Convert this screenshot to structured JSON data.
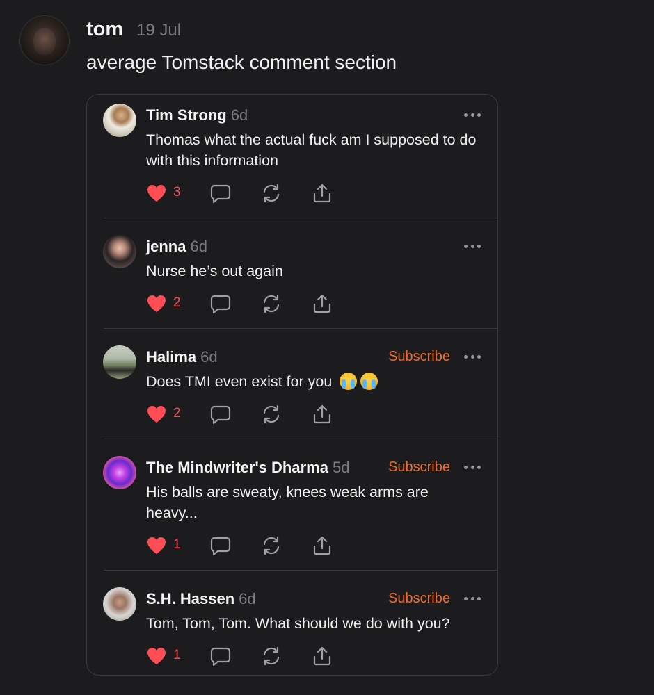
{
  "post": {
    "author": "tom",
    "date": "19 Jul",
    "text": "average Tomstack comment section"
  },
  "comments": [
    {
      "name": "Tim Strong",
      "time": "6d",
      "body": "Thomas what the actual fuck am I supposed to do with this information",
      "subscribe": "",
      "likes": "3"
    },
    {
      "name": "jenna",
      "time": "6d",
      "body": "Nurse he’s out again",
      "subscribe": "",
      "likes": "2"
    },
    {
      "name": "Halima",
      "time": "6d",
      "body": "Does TMI even exist for you",
      "subscribe": "Subscribe",
      "likes": "2",
      "emoji": [
        "loudly-crying-face",
        "loudly-crying-face"
      ]
    },
    {
      "name": "The Mindwriter's Dharma",
      "time": "5d",
      "body": "His balls are sweaty, knees weak arms are heavy...",
      "subscribe": "Subscribe",
      "likes": "1"
    },
    {
      "name": "S.H. Hassen",
      "time": "6d",
      "body": "Tom, Tom, Tom. What should we do with you?",
      "subscribe": "Subscribe",
      "likes": "1"
    }
  ],
  "icons": {
    "like": "heart-icon",
    "reply": "speech-bubble-icon",
    "restack": "restack-arrows-icon",
    "share": "share-upload-icon",
    "more": "more-dots-icon"
  },
  "colors": {
    "background": "#1c1c1e",
    "like_red": "#ff4d55",
    "subscribe_orange": "#f26b2a",
    "muted_text": "#7c7c80"
  }
}
